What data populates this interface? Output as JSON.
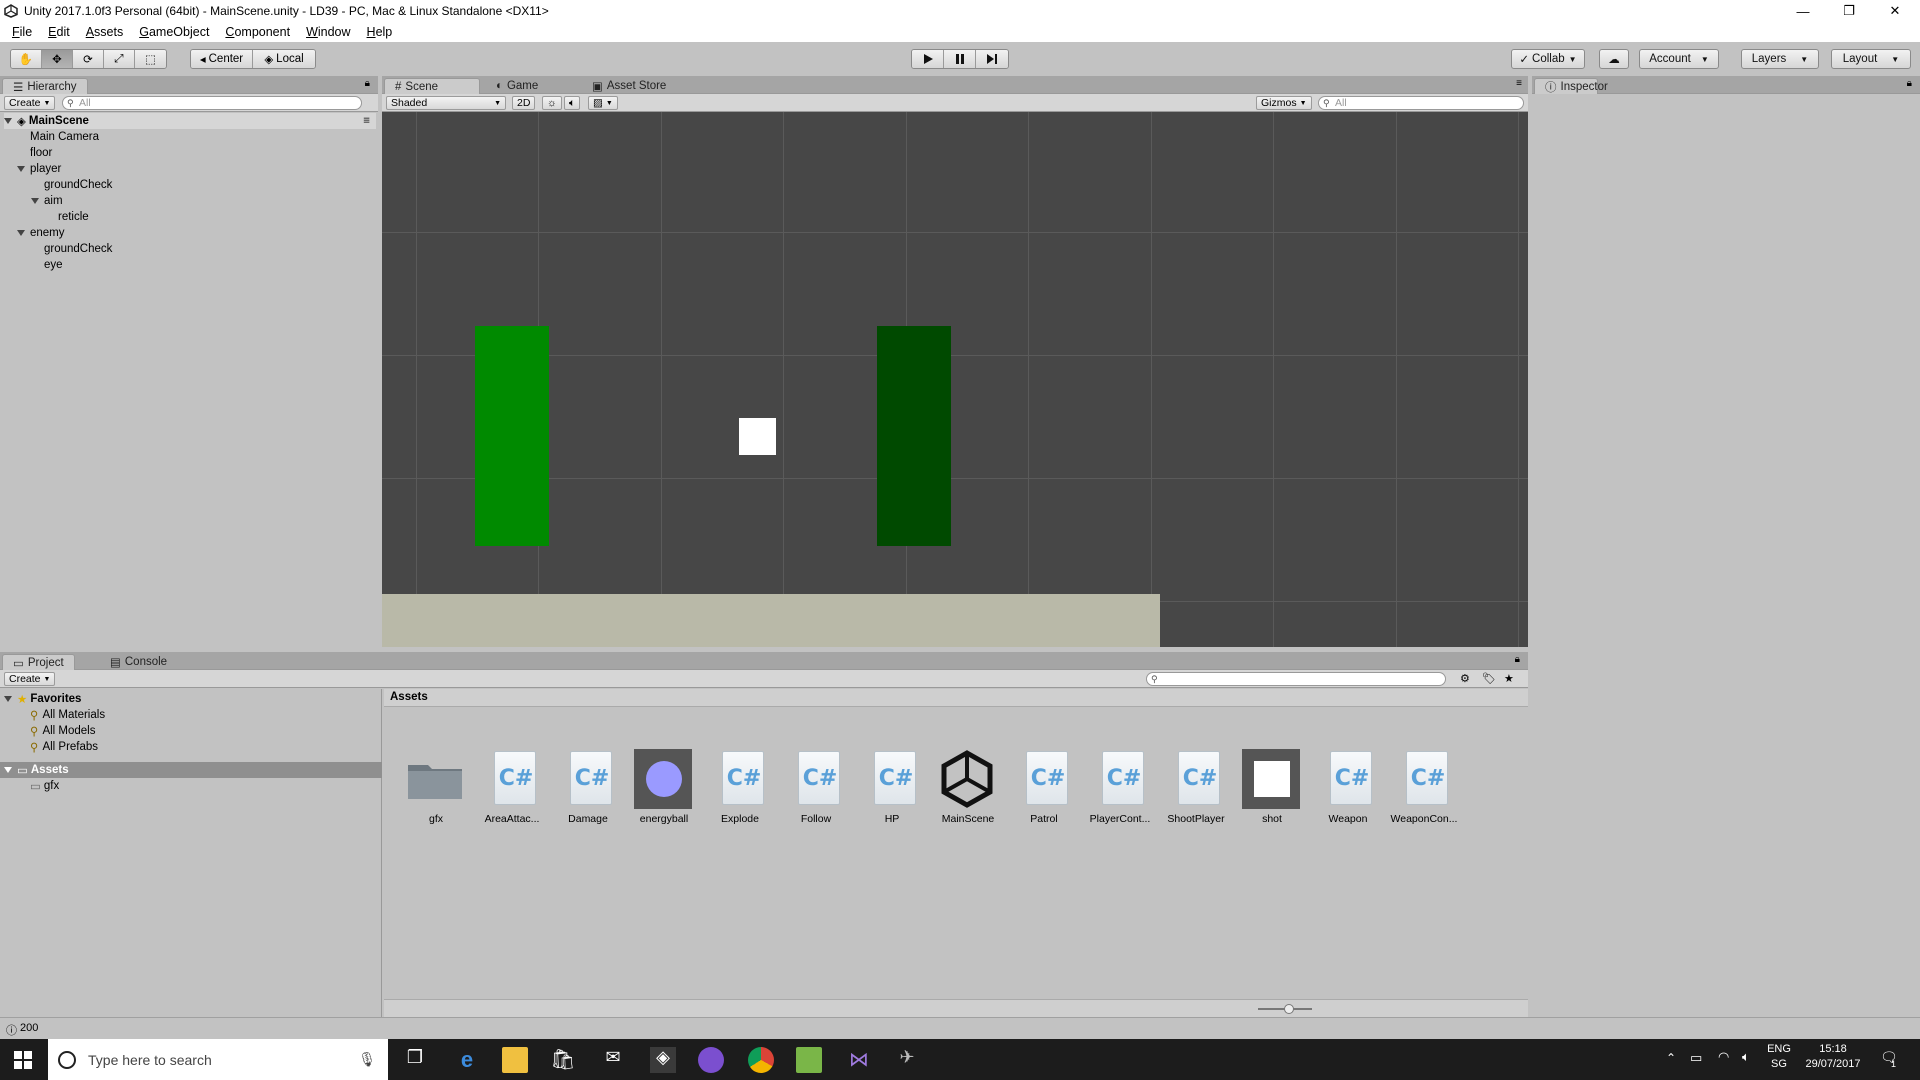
{
  "window": {
    "title": "Unity 2017.1.0f3 Personal (64bit) - MainScene.unity - LD39 - PC, Mac & Linux Standalone <DX11>",
    "controls": [
      "—",
      "❐",
      "✕"
    ]
  },
  "menu": [
    "File",
    "Edit",
    "Assets",
    "GameObject",
    "Component",
    "Window",
    "Help"
  ],
  "toolbar": {
    "pivot": "Center",
    "space": "Local",
    "collab": "Collab",
    "account": "Account",
    "layers": "Layers",
    "layout": "Layout"
  },
  "hierarchy": {
    "tab": "Hierarchy",
    "create": "Create",
    "search_placeholder": "All",
    "scene": "MainScene",
    "items": [
      "Main Camera",
      "floor",
      "player",
      "groundCheck",
      "aim",
      "reticle",
      "enemy",
      "groundCheck",
      "eye"
    ]
  },
  "scene": {
    "tabs": [
      "Scene",
      "Game",
      "Asset Store"
    ],
    "shading": "Shaded",
    "mode_2d": "2D",
    "gizmos": "Gizmos",
    "search_placeholder": "All",
    "colors": {
      "background": "#474747",
      "player": "#008a00",
      "enemy": "#004a00",
      "shot": "#ffffff",
      "floor": "#b9b9a8"
    }
  },
  "inspector": {
    "tab": "Inspector"
  },
  "project": {
    "tabs": [
      "Project",
      "Console"
    ],
    "create": "Create",
    "favorites_label": "Favorites",
    "favorites": [
      "All Materials",
      "All Models",
      "All Prefabs"
    ],
    "assets_label": "Assets",
    "assets_children": [
      "gfx"
    ],
    "breadcrumb": "Assets",
    "assets": [
      {
        "name": "gfx",
        "type": "folder"
      },
      {
        "name": "AreaAttac...",
        "type": "script"
      },
      {
        "name": "Damage",
        "type": "script"
      },
      {
        "name": "energyball",
        "type": "sprite-circle"
      },
      {
        "name": "Explode",
        "type": "script"
      },
      {
        "name": "Follow",
        "type": "script"
      },
      {
        "name": "HP",
        "type": "script"
      },
      {
        "name": "MainScene",
        "type": "scene"
      },
      {
        "name": "Patrol",
        "type": "script"
      },
      {
        "name": "PlayerCont...",
        "type": "script"
      },
      {
        "name": "ShootPlayer",
        "type": "script"
      },
      {
        "name": "shot",
        "type": "sprite-square"
      },
      {
        "name": "Weapon",
        "type": "script"
      },
      {
        "name": "WeaponCon...",
        "type": "script"
      }
    ]
  },
  "status": {
    "message": "200"
  },
  "taskbar": {
    "search_placeholder": "Type here to search",
    "lang1": "ENG",
    "lang2": "SG",
    "time": "15:18",
    "date": "29/07/2017",
    "notifications": "1"
  }
}
